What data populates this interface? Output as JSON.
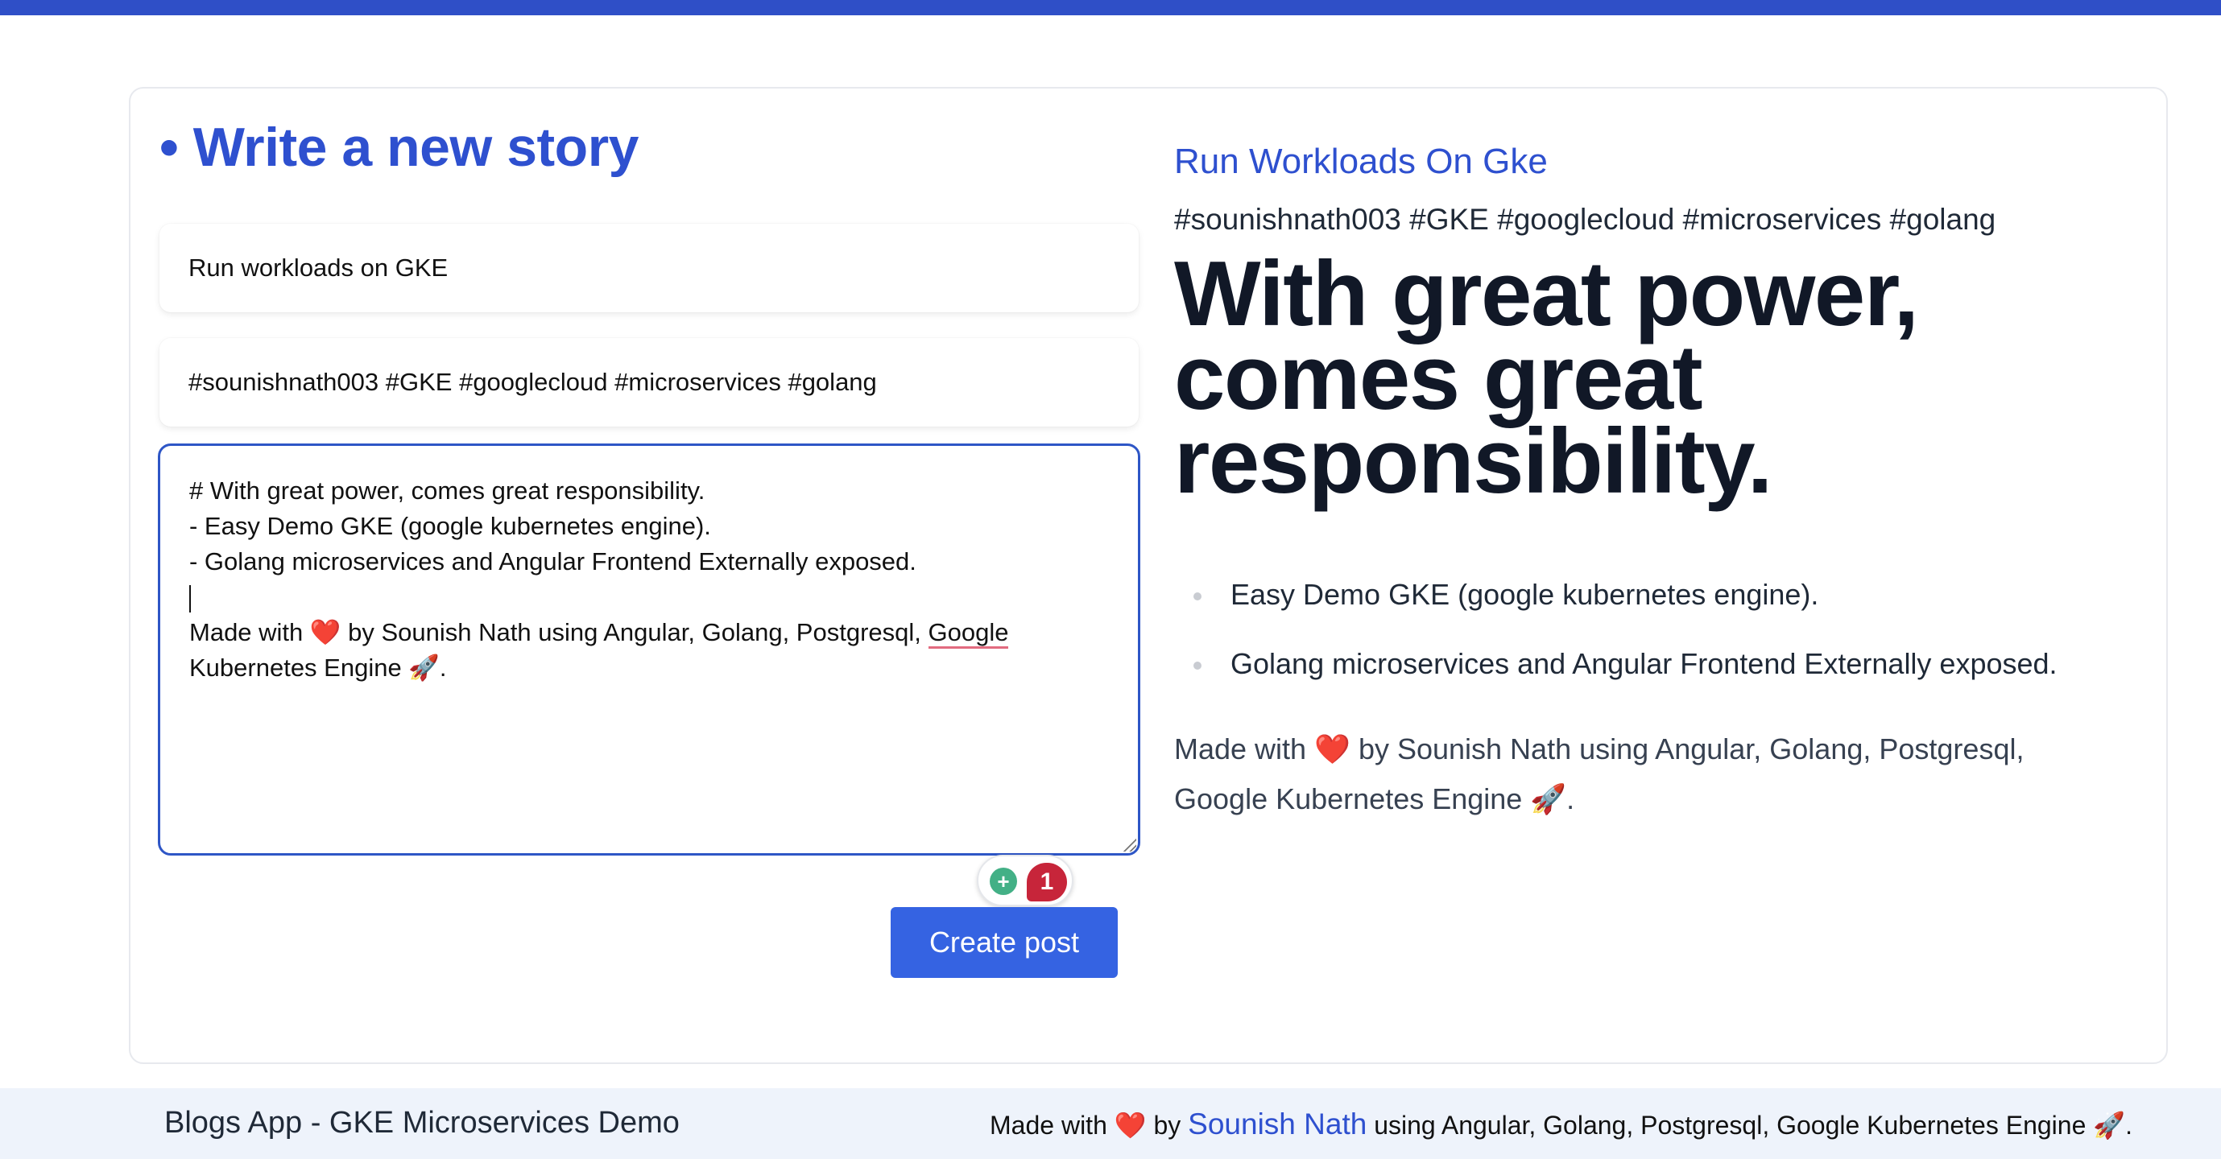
{
  "form": {
    "title": "• Write a new story",
    "title_value": "Run workloads on GKE",
    "tags_value": "#sounishnath003 #GKE #googlecloud #microservices #golang",
    "body_lines": [
      "# With great power, comes great responsibility.",
      "- Easy Demo GKE (google kubernetes engine).",
      "- Golang microservices and Angular Frontend Externally exposed."
    ],
    "made_with_prefix": "Made with",
    "heart": "❤️",
    "made_with_middle": "by Sounish Nath using Angular, Golang, Postgresql,",
    "made_with_underlined": "Google",
    "made_with_suffix": "Kubernetes Engine 🚀.",
    "grammar_count": "1",
    "create_button": "Create post"
  },
  "preview": {
    "title": "Run Workloads On Gke",
    "tags": "#sounishnath003 #GKE #googlecloud #microservices #golang",
    "heading": "With great power, comes great responsibility.",
    "list": [
      "Easy Demo GKE (google kubernetes engine).",
      "Golang microservices and Angular Frontend Externally exposed."
    ],
    "made_with_prefix": "Made with",
    "heart": "❤️",
    "made_with_rest": "by Sounish Nath using Angular, Golang, Postgresql, Google Kubernetes Engine 🚀."
  },
  "footer": {
    "app_name": "Blogs App - GKE Microservices Demo",
    "made_with_prefix": "Made with",
    "heart": "❤️",
    "by": "by",
    "author_link": "Sounish Nath",
    "suffix": "using Angular, Golang, Postgresql, Google Kubernetes Engine 🚀."
  },
  "colors": {
    "accent": "#2e50cf",
    "button": "#3563e2",
    "topbar": "#2f4fc7"
  },
  "icons": [
    "lightbulb-icon",
    "resize-grip-icon",
    "rocket-icon",
    "heart-icon"
  ]
}
